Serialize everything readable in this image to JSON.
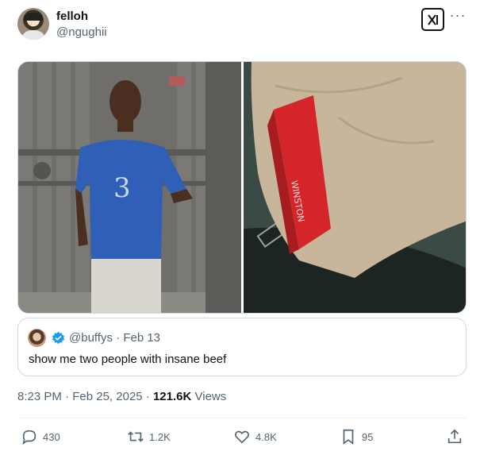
{
  "author": {
    "display_name": "felloh",
    "handle": "@ngughii"
  },
  "quoted_tweet": {
    "handle": "@buffys",
    "separator": "·",
    "date": "Feb 13",
    "text": "show me two people with insane beef"
  },
  "meta": {
    "time": "8:23 PM",
    "dot1": "·",
    "date": "Feb 25, 2025",
    "dot2": "·",
    "views_count": "121.6K",
    "views_label": "Views"
  },
  "actions": {
    "replies": "430",
    "reposts": "1.2K",
    "likes": "4.8K",
    "bookmarks": "95"
  },
  "colors": {
    "text_primary": "#0f1419",
    "text_secondary": "#536471",
    "border": "#cfd9de",
    "verified": "#1d9bf0"
  },
  "icons": [
    "grok-icon",
    "more-icon",
    "verified-icon",
    "reply-icon",
    "repost-icon",
    "like-icon",
    "bookmark-icon",
    "share-icon"
  ]
}
